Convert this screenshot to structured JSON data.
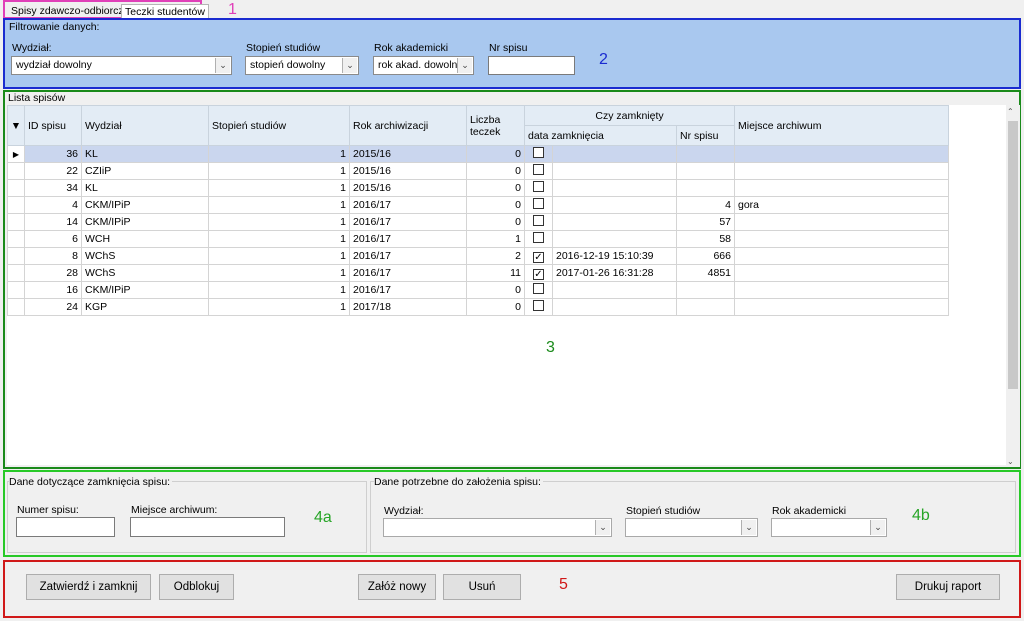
{
  "tabs": [
    {
      "label": "Spisy zdawczo-odbiorcze",
      "active": true
    },
    {
      "label": "Teczki studentów",
      "active": false
    }
  ],
  "markers": {
    "m1": "1",
    "m2": "2",
    "m3": "3",
    "m4a": "4a",
    "m4b": "4b",
    "m5": "5"
  },
  "filter": {
    "title": "Filtrowanie danych:",
    "wydzial": {
      "label": "Wydział:",
      "value": "wydział dowolny"
    },
    "stopien": {
      "label": "Stopień studiów",
      "value": "stopień dowolny"
    },
    "rok": {
      "label": "Rok akademicki",
      "value": "rok akad. dowolny"
    },
    "nr_spisu": {
      "label": "Nr spisu",
      "value": ""
    }
  },
  "list": {
    "title": "Lista spisów",
    "columns": {
      "id": "ID spisu",
      "wydzial": "Wydział",
      "stopien": "Stopień studiów",
      "rok": "Rok archiwizacji",
      "liczba": "Liczba teczek",
      "group": "Czy zamknięty",
      "data": "data zamknięcia",
      "nr": "Nr spisu",
      "miejsce": "Miejsce archiwum"
    },
    "rows": [
      {
        "id": "36",
        "wydzial": "KL",
        "stopien": "1",
        "rok": "2015/16",
        "liczba": "0",
        "zamkniety": false,
        "data": "",
        "nr": "",
        "miejsce": "",
        "selected": true
      },
      {
        "id": "22",
        "wydzial": "CZIiP",
        "stopien": "1",
        "rok": "2015/16",
        "liczba": "0",
        "zamkniety": false,
        "data": "",
        "nr": "",
        "miejsce": ""
      },
      {
        "id": "34",
        "wydzial": "KL",
        "stopien": "1",
        "rok": "2015/16",
        "liczba": "0",
        "zamkniety": false,
        "data": "",
        "nr": "",
        "miejsce": ""
      },
      {
        "id": "4",
        "wydzial": "CKM/IPiP",
        "stopien": "1",
        "rok": "2016/17",
        "liczba": "0",
        "zamkniety": false,
        "data": "",
        "nr": "4",
        "miejsce": "gora"
      },
      {
        "id": "14",
        "wydzial": "CKM/IPiP",
        "stopien": "1",
        "rok": "2016/17",
        "liczba": "0",
        "zamkniety": false,
        "data": "",
        "nr": "57",
        "miejsce": ""
      },
      {
        "id": "6",
        "wydzial": "WCH",
        "stopien": "1",
        "rok": "2016/17",
        "liczba": "1",
        "zamkniety": false,
        "data": "",
        "nr": "58",
        "miejsce": ""
      },
      {
        "id": "8",
        "wydzial": "WChS",
        "stopien": "1",
        "rok": "2016/17",
        "liczba": "2",
        "zamkniety": true,
        "data": "2016-12-19 15:10:39",
        "nr": "666",
        "miejsce": ""
      },
      {
        "id": "28",
        "wydzial": "WChS",
        "stopien": "1",
        "rok": "2016/17",
        "liczba": "11",
        "zamkniety": true,
        "data": "2017-01-26 16:31:28",
        "nr": "4851",
        "miejsce": ""
      },
      {
        "id": "16",
        "wydzial": "CKM/IPiP",
        "stopien": "1",
        "rok": "2016/17",
        "liczba": "0",
        "zamkniety": false,
        "data": "",
        "nr": "",
        "miejsce": ""
      },
      {
        "id": "24",
        "wydzial": "KGP",
        "stopien": "1",
        "rok": "2017/18",
        "liczba": "0",
        "zamkniety": false,
        "data": "",
        "nr": "",
        "miejsce": ""
      }
    ]
  },
  "closing": {
    "title": "Dane dotyczące zamknięcia spisu:",
    "numer_label": "Numer spisu:",
    "numer_value": "",
    "miejsce_label": "Miejsce archiwum:",
    "miejsce_value": ""
  },
  "creation": {
    "title": "Dane potrzebne do założenia spisu:",
    "wydzial_label": "Wydział:",
    "wydzial_value": "",
    "stopien_label": "Stopień studiów",
    "stopien_value": "",
    "rok_label": "Rok akademicki",
    "rok_value": ""
  },
  "buttons": {
    "confirm": "Zatwierdź i zamknij",
    "unlock": "Odblokuj",
    "create": "Załóż nowy",
    "delete": "Usuń",
    "print": "Drukuj raport"
  },
  "colors": {
    "region1": "#e040b8",
    "region2": "#1a2bd0",
    "region3": "#1a8a1a",
    "region4": "#27c927",
    "region5": "#d01818",
    "filter_bg": "#a9c8ef",
    "selected_row": "#cad6ee"
  },
  "icons": {
    "dropdown": "chevron-down-icon",
    "current_row": "row-pointer-icon",
    "sort": "sort-desc-icon",
    "checkbox_checked": "check-icon"
  }
}
